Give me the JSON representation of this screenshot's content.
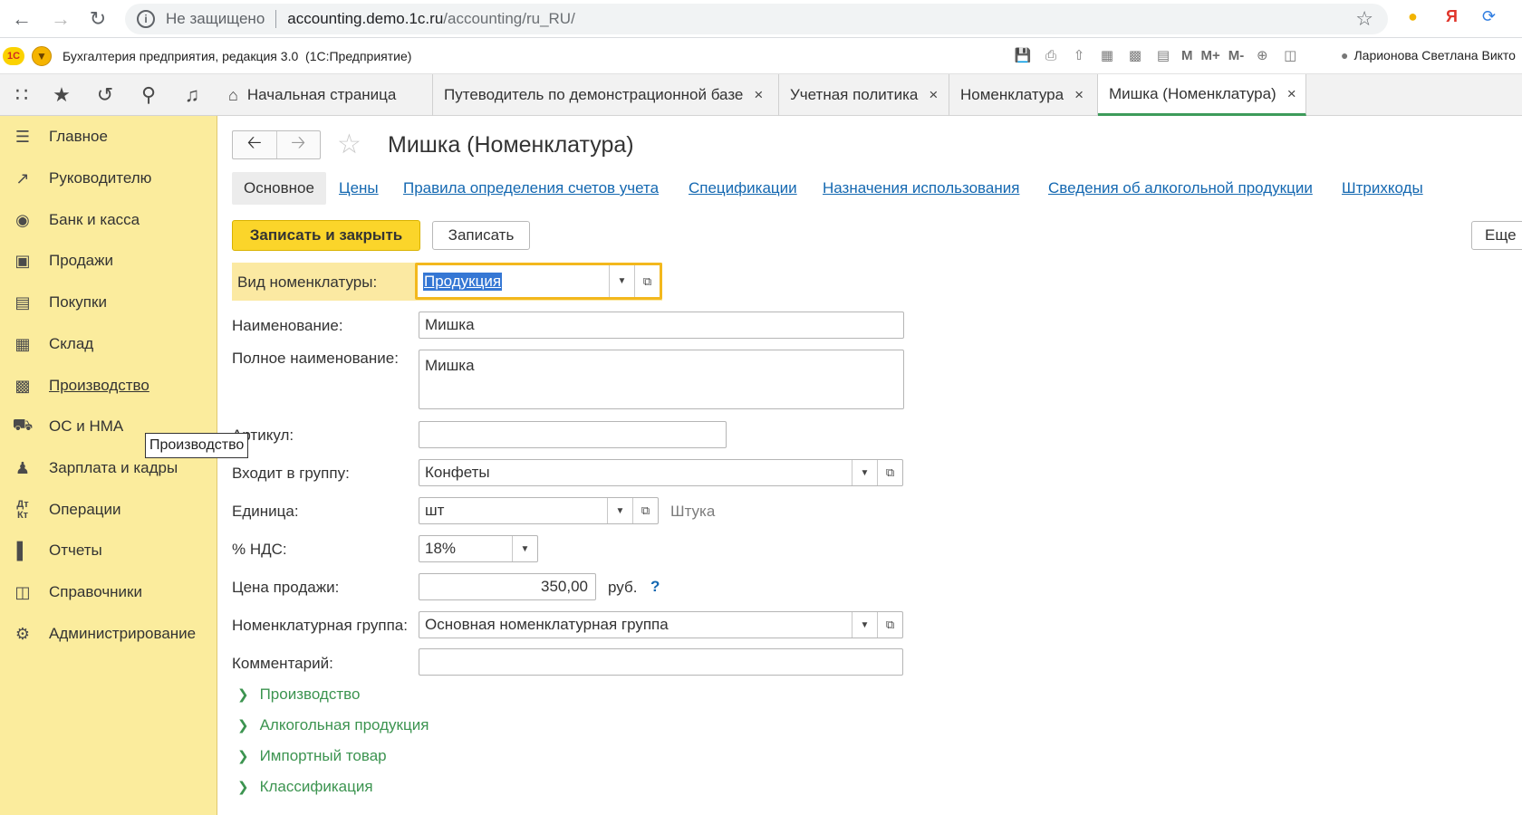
{
  "browser": {
    "security_label": "Не защищено",
    "url_host": "accounting.demo.1c.ru",
    "url_path": "/accounting/ru_RU/",
    "back_icon": "arrow-left-icon",
    "forward_icon": "arrow-right-icon",
    "reload_icon": "reload-icon"
  },
  "app": {
    "logo": "1С",
    "title": "Бухгалтерия предприятия, редакция 3.0",
    "platform": "(1С:Предприятие)",
    "user": "Ларионова Светлана Викто",
    "tools": {
      "m": "M",
      "m_plus": "M+",
      "m_minus": "M-"
    }
  },
  "tabs": [
    {
      "label": "Начальная страница"
    },
    {
      "label": "Путеводитель по демонстрационной базе",
      "close": "×"
    },
    {
      "label": "Учетная политика",
      "close": "×"
    },
    {
      "label": "Номенклатура",
      "close": "×"
    },
    {
      "label": "Мишка (Номенклатура)",
      "close": "×"
    }
  ],
  "sidebar": {
    "items": [
      {
        "label": "Главное",
        "icon": "menu-lines-icon"
      },
      {
        "label": "Руководителю",
        "icon": "trend-chart-icon"
      },
      {
        "label": "Банк и касса",
        "icon": "ruble-coin-icon"
      },
      {
        "label": "Продажи",
        "icon": "shopping-bag-icon"
      },
      {
        "label": "Покупки",
        "icon": "cart-icon"
      },
      {
        "label": "Склад",
        "icon": "warehouse-grid-icon"
      },
      {
        "label": "Производство",
        "icon": "factory-icon"
      },
      {
        "label": "ОС и НМА",
        "icon": "truck-icon"
      },
      {
        "label": "Зарплата и кадры",
        "icon": "person-icon"
      },
      {
        "label": "Операции",
        "icon": "dt-kt-icon"
      },
      {
        "label": "Отчеты",
        "icon": "bar-chart-icon"
      },
      {
        "label": "Справочники",
        "icon": "books-icon"
      },
      {
        "label": "Администрирование",
        "icon": "gear-icon"
      }
    ],
    "tooltip": "Производство"
  },
  "form": {
    "title": "Мишка (Номенклатура)",
    "tabs": [
      "Основное",
      "Цены",
      "Правила определения счетов учета",
      "Спецификации",
      "Назначения использования",
      "Сведения об алкогольной продукции",
      "Штрихкоды"
    ],
    "buttons": {
      "save_close": "Записать и закрыть",
      "save": "Записать",
      "more": "Еще"
    },
    "kind": {
      "label": "Вид номенклатуры:",
      "value": "Продукция"
    },
    "name": {
      "label": "Наименование:",
      "value": "Мишка"
    },
    "full_name": {
      "label": "Полное наименование:",
      "value": "Мишка"
    },
    "article": {
      "label": "Артикул:",
      "value": ""
    },
    "group": {
      "label": "Входит в группу:",
      "value": "Конфеты"
    },
    "unit": {
      "label": "Единица:",
      "value": "шт",
      "hint": "Штука"
    },
    "vat": {
      "label": "% НДС:",
      "value": "18%"
    },
    "price": {
      "label": "Цена продажи:",
      "value": "350,00",
      "currency": "руб.",
      "help": "?"
    },
    "nom_group": {
      "label": "Номенклатурная группа:",
      "value": "Основная номенклатурная группа"
    },
    "comment": {
      "label": "Комментарий:",
      "value": ""
    },
    "groups": [
      "Производство",
      "Алкогольная продукция",
      "Импортный товар",
      "Классификация"
    ]
  }
}
